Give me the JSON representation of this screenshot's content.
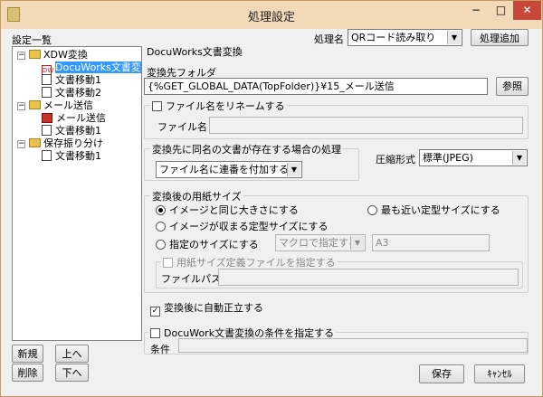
{
  "window": {
    "title": "処理設定",
    "minimize": "−",
    "maximize": "□",
    "close": "✕"
  },
  "header": {
    "process_name_label": "処理名",
    "process_name_value": "QRコード読み取り",
    "add_button": "処理追加"
  },
  "sidebar": {
    "title": "設定一覧",
    "tree": [
      {
        "label": "XDW変換",
        "level": 0,
        "icon": "folder-icon",
        "expand": "−"
      },
      {
        "label": "DocuWorks文書変",
        "level": 1,
        "icon": "docuworks-icon",
        "selected": true
      },
      {
        "label": "文書移動1",
        "level": 1,
        "icon": "document-icon"
      },
      {
        "label": "文書移動2",
        "level": 1,
        "icon": "document-icon"
      },
      {
        "label": "メール送信",
        "level": 0,
        "icon": "folder-icon",
        "expand": "−"
      },
      {
        "label": "メール送信",
        "level": 1,
        "icon": "mail-icon"
      },
      {
        "label": "文書移動1",
        "level": 1,
        "icon": "document-icon"
      },
      {
        "label": "保存振り分け",
        "level": 0,
        "icon": "folder-icon",
        "expand": "−"
      },
      {
        "label": "文書移動1",
        "level": 1,
        "icon": "document-icon"
      }
    ],
    "new_button": "新規",
    "up_button": "上へ",
    "delete_button": "削除",
    "down_button": "下へ"
  },
  "main": {
    "section_title": "DocuWorks文書変換",
    "dest_folder_label": "変換先フォルダ",
    "dest_folder_value": "{%GET_GLOBAL_DATA(TopFolder)}¥15_メール送信",
    "browse_button": "参照",
    "rename": {
      "label": "ファイル名をリネームする",
      "checked": false,
      "file_name_label": "ファイル名",
      "file_name_value": ""
    },
    "duplicate": {
      "label": "変換先に同名の文書が存在する場合の処理",
      "value": "ファイル名に連番を付加する"
    },
    "compression": {
      "label": "圧縮形式",
      "value": "標準(JPEG)"
    },
    "paper_size": {
      "label": "変換後の用紙サイズ",
      "opt_same": "イメージと同じ大きさにする",
      "opt_nearest": "最も近い定型サイズにする",
      "opt_fit": "イメージが収まる定型サイズにする",
      "opt_specified": "指定のサイズにする",
      "selected": "opt_same",
      "macro_select": "マクロで指定する",
      "size_value": "A3",
      "def_file_label": "用紙サイズ定義ファイルを指定する",
      "file_path_label": "ファイルパス",
      "file_path_value": ""
    },
    "auto_upright": {
      "label": "変換後に自動正立する",
      "checked": true
    },
    "condition": {
      "label": "DocuWork文書変換の条件を指定する",
      "checked": false,
      "cond_label": "条件",
      "cond_value": ""
    }
  },
  "footer": {
    "save_button": "保存",
    "cancel_button": "ｷｬﾝｾﾙ"
  }
}
